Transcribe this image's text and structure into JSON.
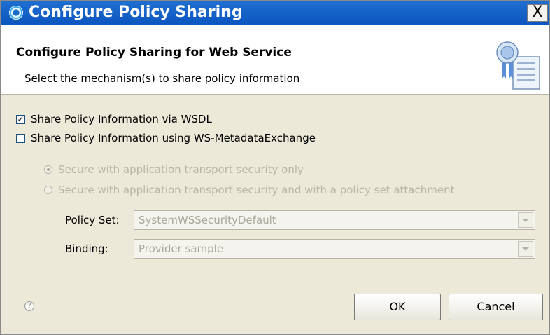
{
  "window": {
    "title": "Configure Policy Sharing",
    "close_label": "X"
  },
  "header": {
    "title": "Configure Policy Sharing for Web Service",
    "description": "Select the mechanism(s) to share policy information",
    "icon": "certificate-document-icon"
  },
  "options": {
    "share_wsdl": {
      "label": "Share Policy Information via WSDL",
      "checked": true
    },
    "share_mex": {
      "label": "Share Policy Information using WS-MetadataExchange",
      "checked": false
    }
  },
  "mex_security": {
    "enabled": false,
    "radios": [
      {
        "label": "Secure with application transport security only",
        "selected": true
      },
      {
        "label": "Secure with application transport security and with a policy set attachment",
        "selected": false
      }
    ]
  },
  "fields": {
    "policy_set": {
      "label": "Policy Set:",
      "value": "SystemWSSecurityDefault"
    },
    "binding": {
      "label": "Binding:",
      "value": "Provider sample"
    }
  },
  "buttons": {
    "help": "?",
    "ok": "OK",
    "cancel": "Cancel"
  },
  "colors": {
    "titlebar": "#0b56bf",
    "dialog_bg": "#ece9d8",
    "disabled_text": "#b8b5a8"
  }
}
